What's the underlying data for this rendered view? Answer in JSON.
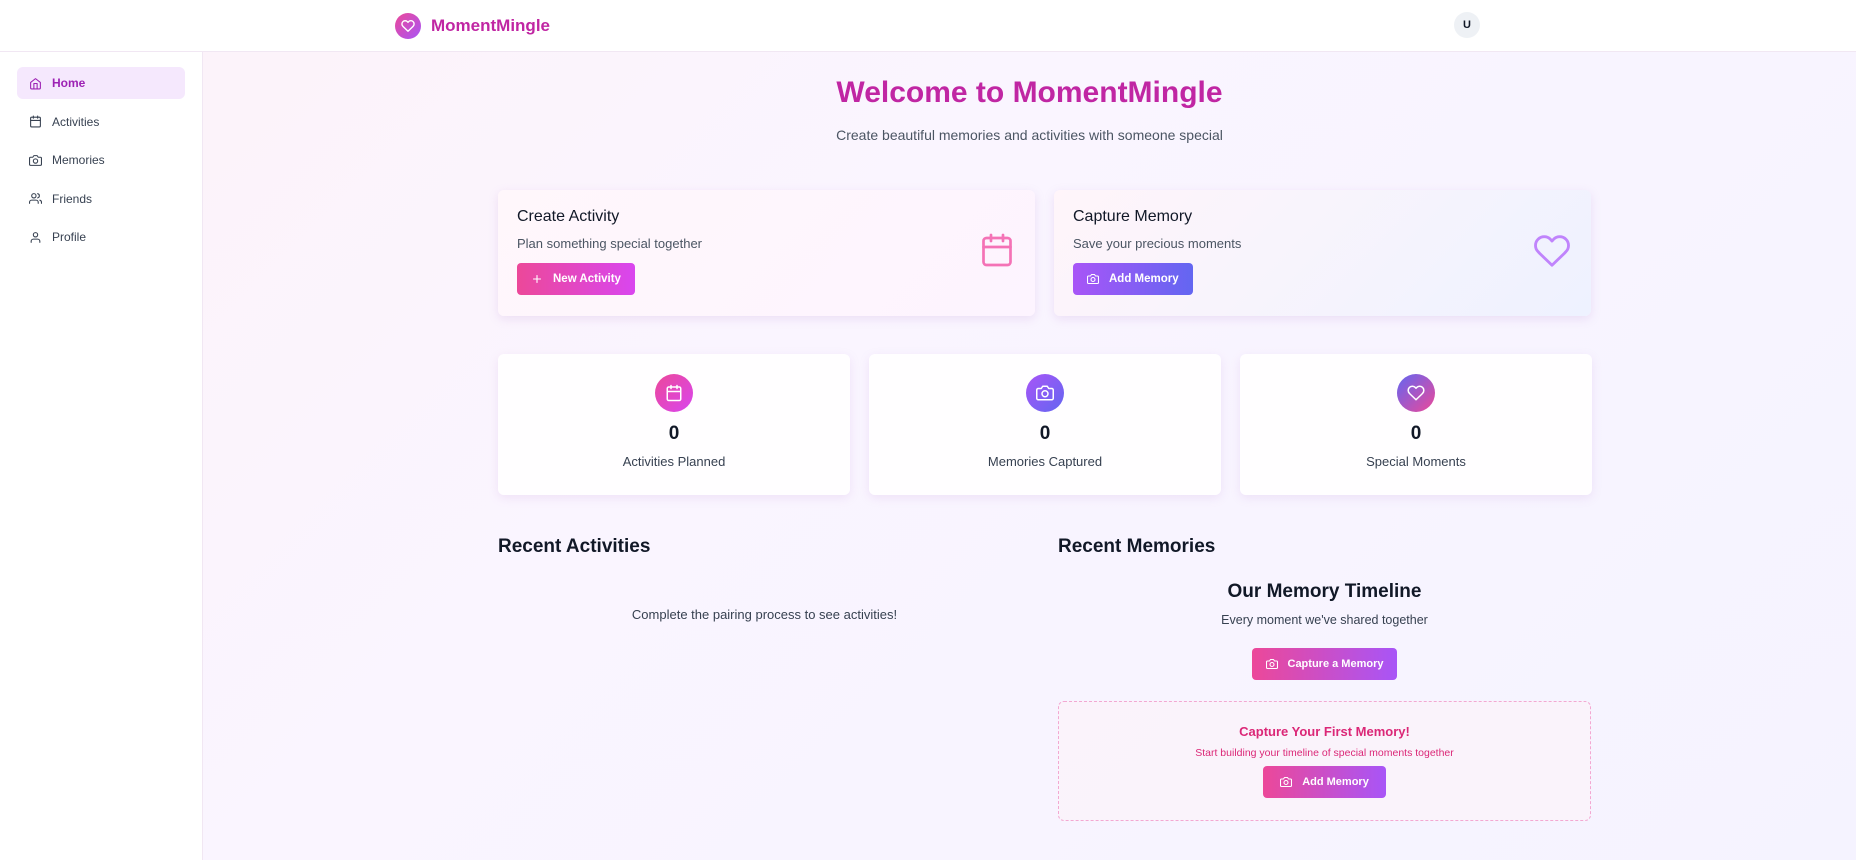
{
  "header": {
    "app_name": "MomentMingle",
    "avatar_initial": "U",
    "brand_gradient": [
      "#ec4899",
      "#a855f7"
    ],
    "brand_color": "#c026a3"
  },
  "sidebar": {
    "items": [
      {
        "label": "Home",
        "icon": "home-icon",
        "active": true
      },
      {
        "label": "Activities",
        "icon": "calendar-icon",
        "active": false
      },
      {
        "label": "Memories",
        "icon": "camera-icon",
        "active": false
      },
      {
        "label": "Friends",
        "icon": "users-icon",
        "active": false
      },
      {
        "label": "Profile",
        "icon": "user-icon",
        "active": false
      }
    ]
  },
  "hero": {
    "title": "Welcome to MomentMingle",
    "subtitle": "Create beautiful memories and activities with someone special"
  },
  "actions": {
    "create_activity": {
      "title": "Create Activity",
      "description": "Plan something special together",
      "button_label": "New Activity",
      "icon": "calendar-icon"
    },
    "capture_memory": {
      "title": "Capture Memory",
      "description": "Save your precious moments",
      "button_label": "Add Memory",
      "icon": "heart-icon"
    }
  },
  "stats": [
    {
      "value": "0",
      "label": "Activities Planned",
      "icon": "calendar-icon"
    },
    {
      "value": "0",
      "label": "Memories Captured",
      "icon": "camera-icon"
    },
    {
      "value": "0",
      "label": "Special Moments",
      "icon": "heart-icon"
    }
  ],
  "recent_activities": {
    "title": "Recent Activities",
    "empty_text": "Complete the pairing process to see activities!"
  },
  "recent_memories": {
    "title": "Recent Memories",
    "timeline_title": "Our Memory Timeline",
    "timeline_subtitle": "Every moment we've shared together",
    "capture_button_label": "Capture a Memory",
    "empty_title": "Capture Your First Memory!",
    "empty_subtitle": "Start building your timeline of special moments together",
    "add_button_label": "Add Memory"
  }
}
